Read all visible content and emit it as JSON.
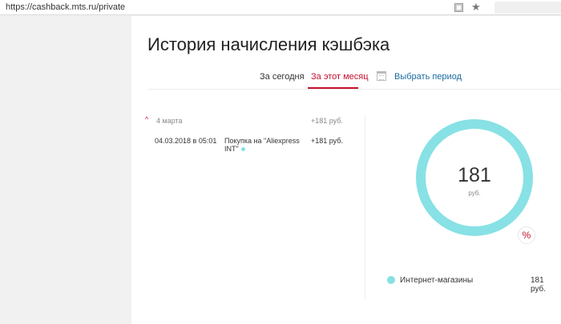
{
  "browser": {
    "url": "https://cashback.mts.ru/private",
    "star": "★"
  },
  "page": {
    "title": "История начисления кэшбэка"
  },
  "tabs": {
    "today": "За сегодня",
    "this_month": "За этот месяц",
    "choose_period": "Выбрать период",
    "active": "this_month"
  },
  "history": {
    "groups": [
      {
        "chevron": "^",
        "date": "4 марта",
        "total": "+181 руб.",
        "items": [
          {
            "datetime": "04.03.2018 в 05:01",
            "description": "Покупка на \"Aliexpress INT\"",
            "amount": "+181 руб."
          }
        ]
      }
    ]
  },
  "summary": {
    "value": "181",
    "unit": "руб.",
    "badge": "%",
    "ring_color": "#87e1e5",
    "ring_fraction": 1.0,
    "legend": [
      {
        "label": "Интернет-магазины",
        "amount": "181 руб.",
        "color": "#87e1e5"
      }
    ]
  },
  "colors": {
    "accent": "#c8102e",
    "link": "#1a6aa0",
    "ring": "#87e1e5"
  }
}
